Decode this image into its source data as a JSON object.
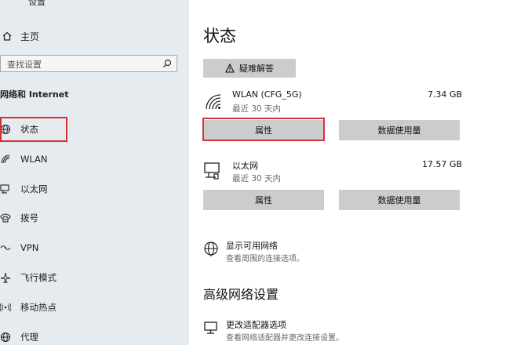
{
  "sidebar": {
    "window_title": "设置",
    "home_label": "主页",
    "search_placeholder": "查找设置",
    "section_label": "网络和 Internet",
    "items": [
      {
        "label": "状态",
        "icon": "globe-icon"
      },
      {
        "label": "WLAN",
        "icon": "wifi-icon"
      },
      {
        "label": "以太网",
        "icon": "ethernet-icon"
      },
      {
        "label": "拨号",
        "icon": "dialup-icon"
      },
      {
        "label": "VPN",
        "icon": "vpn-icon"
      },
      {
        "label": "飞行模式",
        "icon": "airplane-icon"
      },
      {
        "label": "移动热点",
        "icon": "hotspot-icon"
      },
      {
        "label": "代理",
        "icon": "globe-icon"
      }
    ]
  },
  "main": {
    "title": "状态",
    "troubleshoot_label": "疑难解答",
    "networks": [
      {
        "name": "WLAN (CFG_5G)",
        "period": "最近 30 天内",
        "usage": "7.34 GB",
        "props_label": "属性",
        "data_label": "数据使用量"
      },
      {
        "name": "以太网",
        "period": "最近 30 天内",
        "usage": "17.57 GB",
        "props_label": "属性",
        "data_label": "数据使用量"
      }
    ],
    "show_networks": {
      "title": "显示可用网络",
      "desc": "查看周围的连接选项。"
    },
    "advanced_heading": "高级网络设置",
    "adapter": {
      "title": "更改适配器选项",
      "desc": "查看网络适配器并更改连接设置。"
    }
  },
  "colors": {
    "highlight": "#d63035",
    "sidebar_bg": "#e6ebef",
    "button_bg": "#cccccc"
  }
}
